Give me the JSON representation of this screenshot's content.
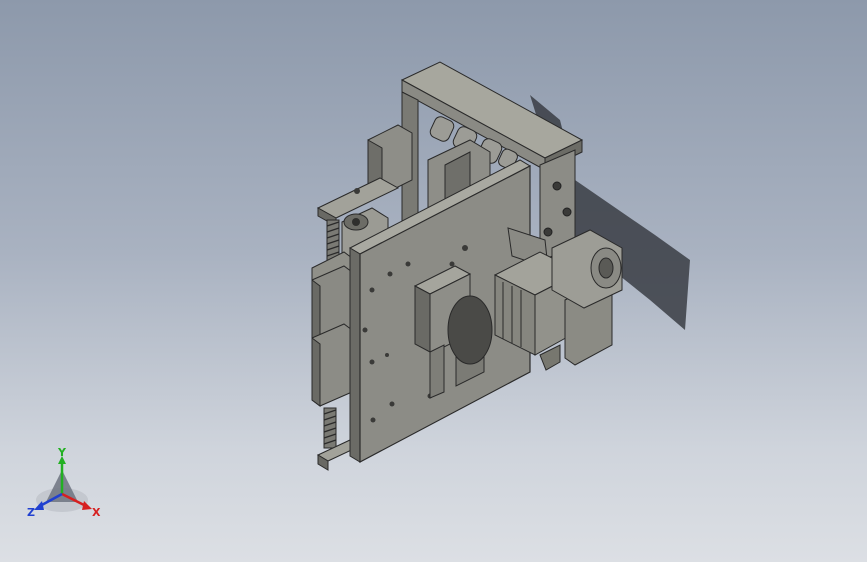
{
  "viewport": {
    "background_top": "#8d99ab",
    "background_bottom": "#dcdfe4",
    "model_color": "#8a8a86"
  },
  "triad": {
    "x_label": "X",
    "y_label": "Y",
    "z_label": "Z",
    "x_color": "#d62020",
    "y_color": "#22b022",
    "z_color": "#2040d0"
  }
}
